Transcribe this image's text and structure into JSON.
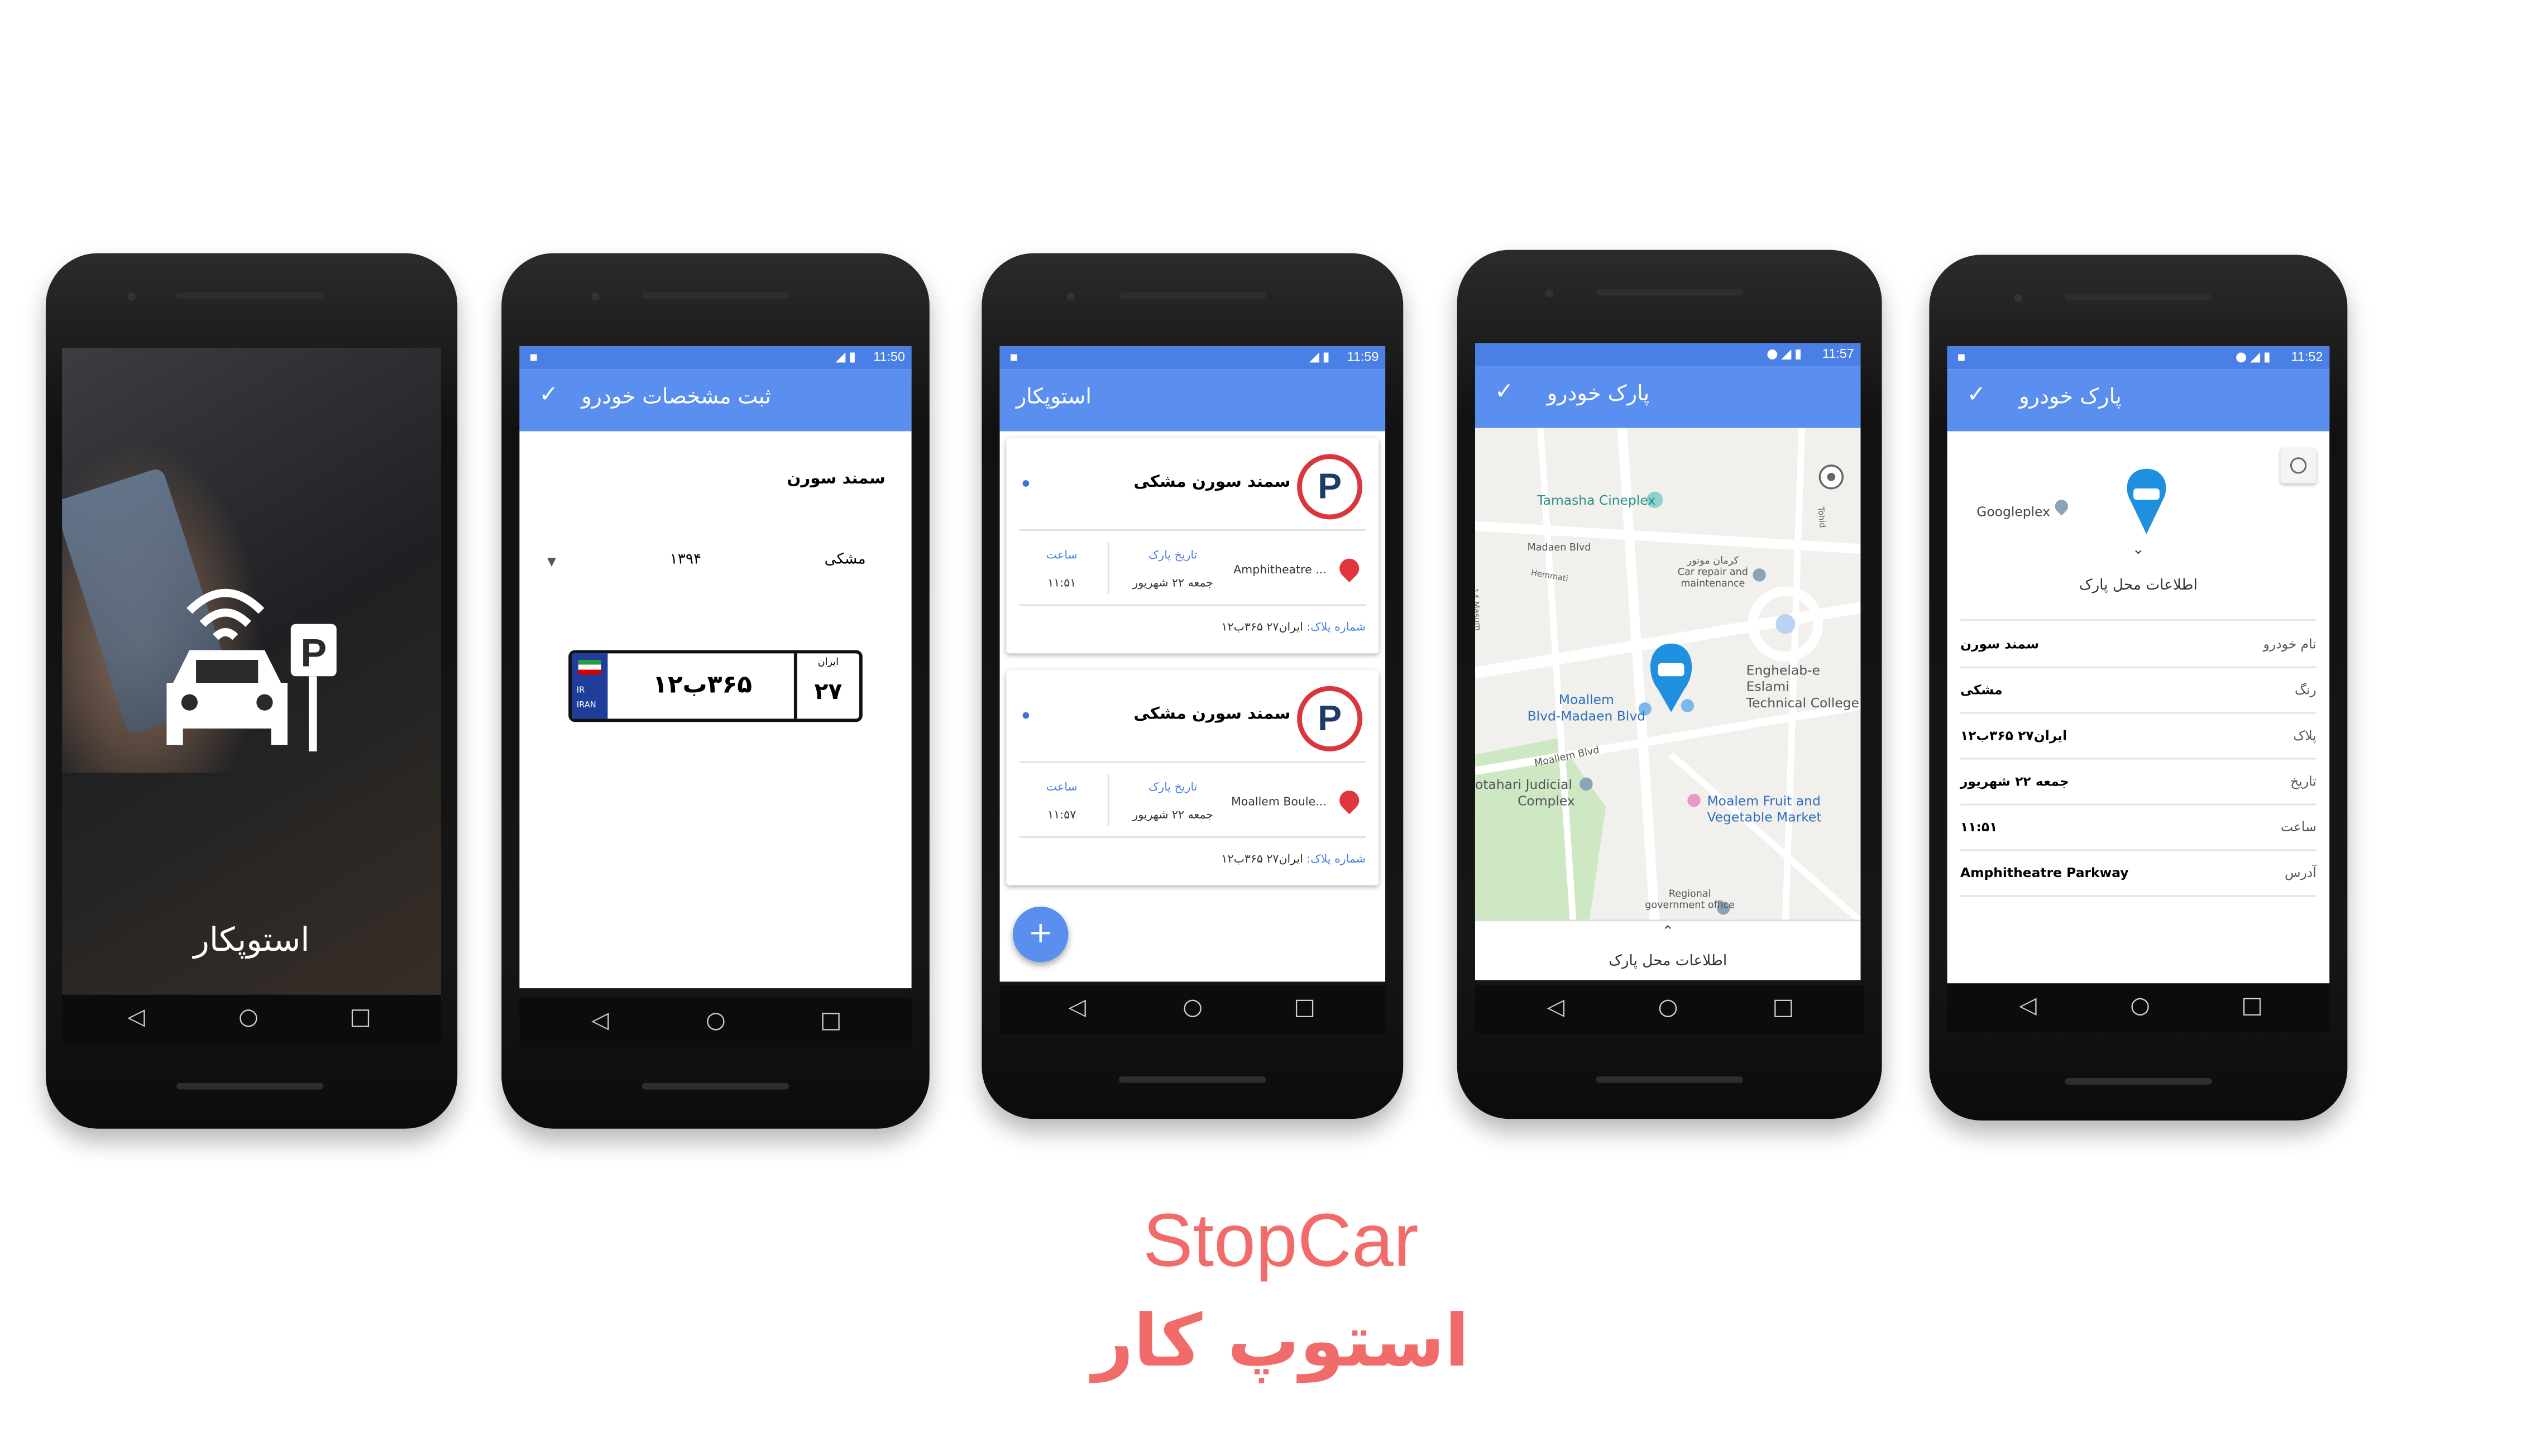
{
  "brand": {
    "title_en": "StopCar",
    "title_fa": "استوپ کار",
    "accent": "#f26b6b",
    "primary": "#5a8ff0",
    "statusbar": "#4a80e6"
  },
  "screen1": {
    "app_name": "استوپکار"
  },
  "screen2": {
    "time": "11:50",
    "title": "ثبت مشخصات خودرو",
    "car_name": "سمند سورن",
    "color": "مشکی",
    "year": "۱۳۹۴",
    "plate": {
      "country": "IR",
      "country_name": "IRAN",
      "main": "۳۶۵ب۱۲",
      "region_label": "ایران",
      "region": "۲۷"
    }
  },
  "screen3": {
    "time": "11:59",
    "title": "استوپکار",
    "cards": [
      {
        "car": "سمند سورن مشکی",
        "date_label": "تاریخ پارک",
        "date": "جمعه ۲۲ شهریور",
        "time_label": "ساعت",
        "time": "۱۱:۵۱",
        "address": "Amphitheatre ...",
        "plate_label": "شماره پلاک:",
        "plate": "ایران۲۷ ۳۶۵ب۱۲"
      },
      {
        "car": "سمند سورن مشکی",
        "date_label": "تاریخ پارک",
        "date": "جمعه ۲۲ شهریور",
        "time_label": "ساعت",
        "time": "۱۱:۵۷",
        "address": "Moallem Boule...",
        "plate_label": "شماره پلاک:",
        "plate": "ایران۲۷ ۳۶۵ب۱۲"
      }
    ],
    "fab": "+"
  },
  "screen4": {
    "time": "11:57",
    "title": "پارک خودرو",
    "map_labels": {
      "tamasha": "Tamasha Cineplex",
      "madaen": "Madaen Blvd",
      "kerman1": "کرمان موتور",
      "kerman2": "Car repair and",
      "kerman3": "maintenance",
      "moallem1": "Moallem",
      "moallem2": "Blvd-Madaen Blvd",
      "engh1": "Enghelab-e Eslami",
      "engh2": "Technical College",
      "moallem_blvd": "Moallem Blvd",
      "judicial1": "otahari Judicial",
      "judicial2": "Complex",
      "fruit1": "Moalem Fruit and",
      "fruit2": "Vegetable Market",
      "regional1": "Regional",
      "regional2": "government office",
      "hammati": "Hemmati",
      "masum": "14 Masum",
      "tohid": "Tohid"
    },
    "sheet_label": "اطلاعات محل پارک"
  },
  "screen5": {
    "time": "11:52",
    "title": "پارک خودرو",
    "poi": "Googleplex",
    "sheet_label": "اطلاعات محل پارک",
    "rows": [
      {
        "label": "نام خودرو",
        "value": "سمند سورن"
      },
      {
        "label": "رنگ",
        "value": "مشکی"
      },
      {
        "label": "پلاک",
        "value": "ایران۲۷ ۳۶۵ب۱۲"
      },
      {
        "label": "تاریخ",
        "value": "جمعه ۲۲ شهریور"
      },
      {
        "label": "ساعت",
        "value": "۱۱:۵۱"
      },
      {
        "label": "آدرس",
        "value": "Amphitheatre Parkway"
      }
    ]
  },
  "nav": {
    "back": "◁",
    "home": "○",
    "recents": "□"
  },
  "icons": {
    "check": "✓",
    "chevron_up": "⌃",
    "chevron_down": "⌄"
  }
}
